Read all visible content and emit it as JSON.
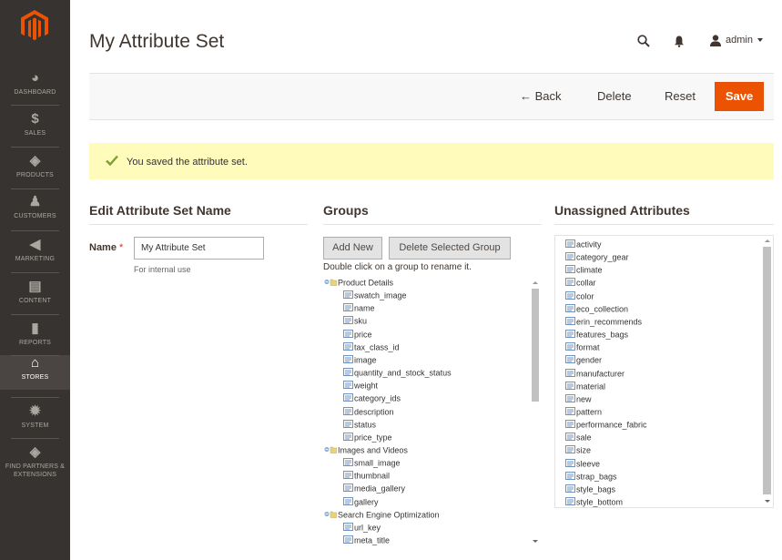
{
  "nav": {
    "items": [
      {
        "label": "DASHBOARD",
        "icon": "dashboard-icon",
        "glyph": "◕"
      },
      {
        "label": "SALES",
        "icon": "dollar-icon",
        "glyph": "$"
      },
      {
        "label": "PRODUCTS",
        "icon": "cube-icon",
        "glyph": "◈"
      },
      {
        "label": "CUSTOMERS",
        "icon": "person-icon",
        "glyph": "♟"
      },
      {
        "label": "MARKETING",
        "icon": "megaphone-icon",
        "glyph": "◀"
      },
      {
        "label": "CONTENT",
        "icon": "layout-icon",
        "glyph": "▤"
      },
      {
        "label": "REPORTS",
        "icon": "bar-chart-icon",
        "glyph": "▮"
      },
      {
        "label": "STORES",
        "icon": "store-icon",
        "glyph": "⌂"
      },
      {
        "label": "SYSTEM",
        "icon": "gear-icon",
        "glyph": "✹"
      },
      {
        "label": "FIND PARTNERS & EXTENSIONS",
        "icon": "box-icon",
        "glyph": "◈"
      }
    ],
    "active": "STORES"
  },
  "header": {
    "title": "My Attribute Set",
    "user": "admin"
  },
  "actions": {
    "back": "Back",
    "delete": "Delete",
    "reset": "Reset",
    "save": "Save"
  },
  "message": {
    "text": "You saved the attribute set."
  },
  "edit": {
    "title": "Edit Attribute Set Name",
    "name_label": "Name",
    "required_mark": "*",
    "name_value": "My Attribute Set",
    "note": "For internal use"
  },
  "groups": {
    "title": "Groups",
    "add_new": "Add New",
    "delete_selected": "Delete Selected Group",
    "hint": "Double click on a group to rename it.",
    "tree": [
      {
        "name": "Product Details",
        "children": [
          "swatch_image",
          "name",
          "sku",
          "price",
          "tax_class_id",
          "image",
          "quantity_and_stock_status",
          "weight",
          "category_ids",
          "description",
          "status",
          "price_type"
        ]
      },
      {
        "name": "Images and Videos",
        "children": [
          "small_image",
          "thumbnail",
          "media_gallery",
          "gallery"
        ]
      },
      {
        "name": "Search Engine Optimization",
        "children": [
          "url_key",
          "meta_title"
        ]
      }
    ]
  },
  "unassigned": {
    "title": "Unassigned Attributes",
    "items": [
      "activity",
      "category_gear",
      "climate",
      "collar",
      "color",
      "eco_collection",
      "erin_recommends",
      "features_bags",
      "format",
      "gender",
      "manufacturer",
      "material",
      "new",
      "pattern",
      "performance_fabric",
      "sale",
      "size",
      "sleeve",
      "strap_bags",
      "style_bags",
      "style_bottom"
    ]
  },
  "colors": {
    "accent": "#eb5202",
    "sidebar": "#373330",
    "message_bg": "#fffbbb",
    "success": "#79a22e"
  }
}
